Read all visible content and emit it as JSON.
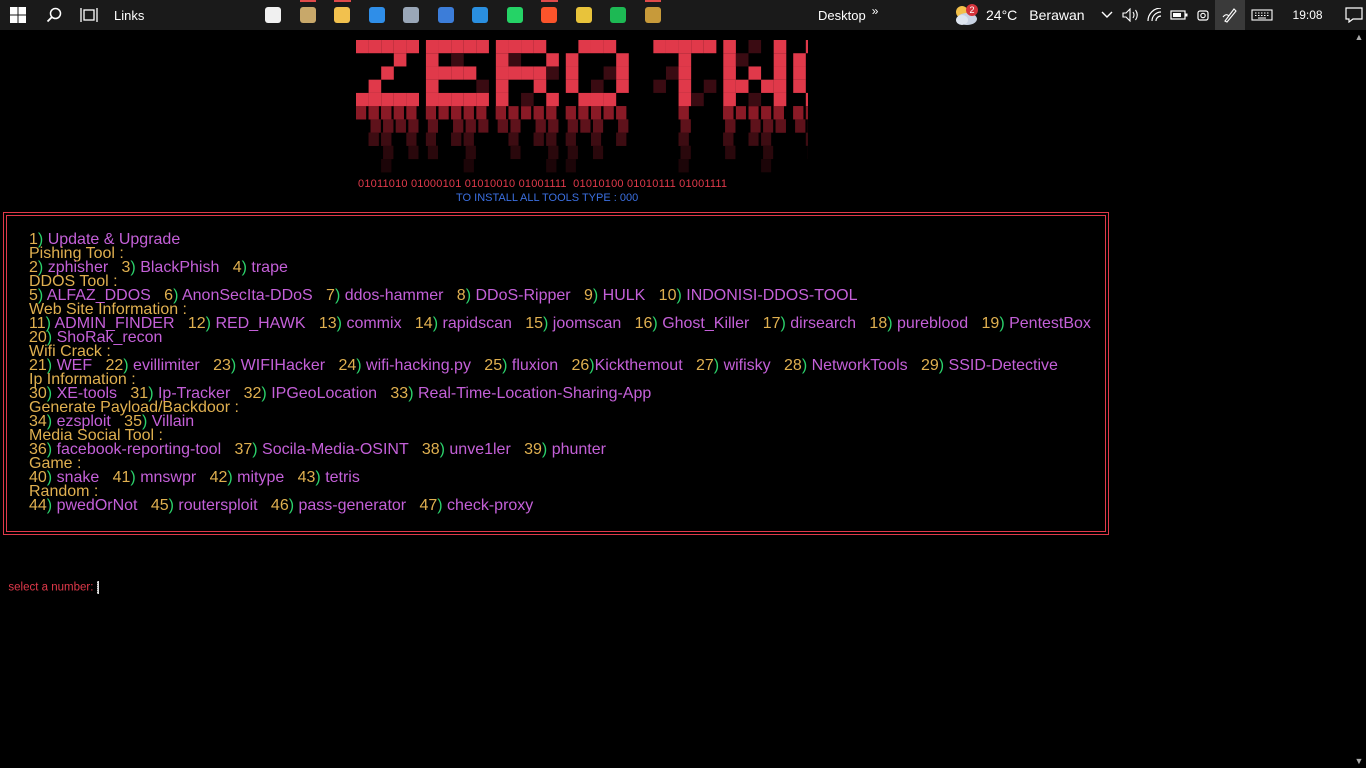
{
  "taskbar": {
    "links_label": "Links",
    "apps": [
      {
        "icon": "tag-app-icon",
        "color": "#f0f0f0",
        "running": false
      },
      {
        "icon": "file-explorer-alt-icon",
        "color": "#c8a86a",
        "running": true
      },
      {
        "icon": "folder-icon",
        "color": "#f2c14e",
        "running": true
      },
      {
        "icon": "microsoft-store-icon",
        "color": "#2f8ee8",
        "running": false
      },
      {
        "icon": "image-viewer-icon",
        "color": "#9aa7b8",
        "running": false
      },
      {
        "icon": "terminal-app-icon",
        "color": "#3c7dd9",
        "running": false
      },
      {
        "icon": "vscode-icon",
        "color": "#2a8fe0",
        "running": false
      },
      {
        "icon": "whatsapp-icon",
        "color": "#25d366",
        "running": false
      },
      {
        "icon": "brave-icon",
        "color": "#fb542b",
        "running": true
      },
      {
        "icon": "chrome-icon",
        "color": "#e8c33b",
        "running": false
      },
      {
        "icon": "spotify-icon",
        "color": "#1db954",
        "running": false
      },
      {
        "icon": "git-tool-icon",
        "color": "#c79a3a",
        "running": true
      }
    ],
    "desktop_label": "Desktop",
    "desktop_chevron": "»",
    "weather_badge": "2",
    "temperature": "24°C",
    "weather_condition": "Berawan",
    "clock": "19:08"
  },
  "terminal": {
    "binary_line": "01011010 01000101 01010010 01001111  01010100 01010111 01001111",
    "install_hint": "TO INSTALL ALL TOOLS TYPE : 000",
    "menu": [
      {
        "type": "items",
        "items": [
          {
            "num": "1",
            "name": "Update & Upgrade"
          }
        ]
      },
      {
        "type": "cat",
        "label": "Pishing Tool :"
      },
      {
        "type": "items",
        "items": [
          {
            "num": "2",
            "name": "zphisher"
          },
          {
            "num": "3",
            "name": "BlackPhish"
          },
          {
            "num": "4",
            "name": "trape"
          }
        ]
      },
      {
        "type": "cat",
        "label": "DDOS Tool :"
      },
      {
        "type": "items",
        "items": [
          {
            "num": "5",
            "name": "ALFAZ_DDOS"
          },
          {
            "num": "6",
            "name": "AnonSecIta-DDoS"
          },
          {
            "num": "7",
            "name": "ddos-hammer"
          },
          {
            "num": "8",
            "name": "DDoS-Ripper"
          },
          {
            "num": "9",
            "name": "HULK"
          },
          {
            "num": "10",
            "name": "INDONISI-DDOS-TOOL"
          }
        ]
      },
      {
        "type": "cat",
        "label": "Web Site Information :"
      },
      {
        "type": "items",
        "items": [
          {
            "num": "11",
            "name": "ADMIN_FINDER"
          },
          {
            "num": "12",
            "name": "RED_HAWK"
          },
          {
            "num": "13",
            "name": "commix"
          },
          {
            "num": "14",
            "name": "rapidscan"
          },
          {
            "num": "15",
            "name": "joomscan"
          },
          {
            "num": "16",
            "name": "Ghost_Killer"
          },
          {
            "num": "17",
            "name": "dirsearch"
          },
          {
            "num": "18",
            "name": "pureblood"
          },
          {
            "num": "19",
            "name": "PentestBox"
          }
        ]
      },
      {
        "type": "items",
        "items": [
          {
            "num": "20",
            "name": "ShoRak_recon"
          }
        ]
      },
      {
        "type": "cat",
        "label": "Wifi Crack :"
      },
      {
        "type": "items",
        "items": [
          {
            "num": "21",
            "name": "WEF"
          },
          {
            "num": "22",
            "name": "evillimiter"
          },
          {
            "num": "23",
            "name": "WIFIHacker"
          },
          {
            "num": "24",
            "name": "wifi-hacking.py"
          },
          {
            "num": "25",
            "name": "fluxion"
          },
          {
            "num": "26",
            "name": "Kickthemout",
            "tight": true
          },
          {
            "num": "27",
            "name": "wifisky"
          },
          {
            "num": "28",
            "name": "NetworkTools"
          },
          {
            "num": "29",
            "name": "SSID-Detective"
          }
        ]
      },
      {
        "type": "cat",
        "label": "Ip Information :"
      },
      {
        "type": "items",
        "items": [
          {
            "num": "30",
            "name": "XE-tools"
          },
          {
            "num": "31",
            "name": "Ip-Tracker"
          },
          {
            "num": "32",
            "name": "IPGeoLocation"
          },
          {
            "num": "33",
            "name": "Real-Time-Location-Sharing-App"
          }
        ]
      },
      {
        "type": "cat",
        "label": "Generate Payload/Backdoor :"
      },
      {
        "type": "items",
        "items": [
          {
            "num": "34",
            "name": "ezsploit"
          },
          {
            "num": "35",
            "name": "Villain"
          }
        ]
      },
      {
        "type": "cat",
        "label": "Media Social Tool :"
      },
      {
        "type": "items",
        "items": [
          {
            "num": "36",
            "name": "facebook-reporting-tool"
          },
          {
            "num": "37",
            "name": "Socila-Media-OSINT"
          },
          {
            "num": "38",
            "name": "unve1ler"
          },
          {
            "num": "39",
            "name": "phunter"
          }
        ]
      },
      {
        "type": "cat",
        "label": "Game :"
      },
      {
        "type": "items",
        "items": [
          {
            "num": "40",
            "name": "snake"
          },
          {
            "num": "41",
            "name": "mnswpr"
          },
          {
            "num": "42",
            "name": "mitype"
          },
          {
            "num": "43",
            "name": "tetris"
          }
        ]
      },
      {
        "type": "cat",
        "label": "Random :"
      },
      {
        "type": "items",
        "items": [
          {
            "num": "44",
            "name": "pwedOrNot"
          },
          {
            "num": "45",
            "name": "routersploit"
          },
          {
            "num": "46",
            "name": "pass-generator"
          },
          {
            "num": "47",
            "name": "check-proxy"
          }
        ]
      }
    ],
    "prompt": "select a number:"
  },
  "colors": {
    "banner_red": "#e0394a",
    "category": "#e0b050",
    "paren": "#2bd26b",
    "tool": "#c460d8",
    "install": "#3b6fe0"
  }
}
